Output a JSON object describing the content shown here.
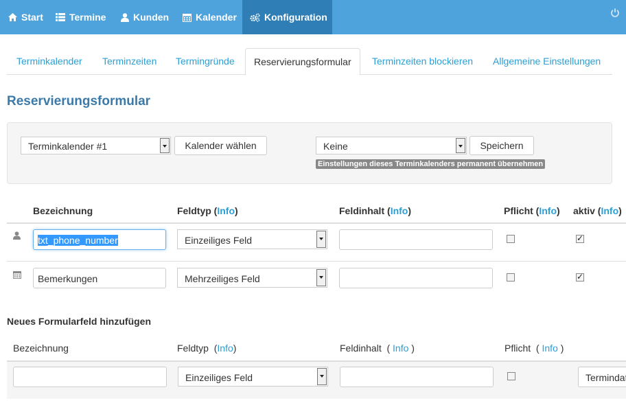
{
  "nav": {
    "items": [
      {
        "label": "Start",
        "icon": "home-icon"
      },
      {
        "label": "Termine",
        "icon": "list-icon"
      },
      {
        "label": "Kunden",
        "icon": "user-icon"
      },
      {
        "label": "Kalender",
        "icon": "calendar-icon"
      },
      {
        "label": "Konfiguration",
        "icon": "cogs-icon",
        "active": true
      }
    ],
    "power_icon": "power-icon"
  },
  "tabs": [
    {
      "label": "Terminkalender"
    },
    {
      "label": "Terminzeiten"
    },
    {
      "label": "Termingründe"
    },
    {
      "label": "Reservierungsformular",
      "active": true
    },
    {
      "label": "Terminzeiten blockieren"
    },
    {
      "label": "Allgemeine Einstellungen"
    }
  ],
  "page_title": "Reservierungsformular",
  "toolbar": {
    "calendar_select": "Terminkalender #1",
    "choose_button": "Kalender wählen",
    "preset_select": "Keine",
    "save_button": "Speichern",
    "hint": "Einstellungen dieses Terminkalenders permanent übernehmen"
  },
  "table": {
    "headers": {
      "bezeichnung": "Bezeichnung",
      "feldtyp": "Feldtyp",
      "feldinhalt": "Feldinhalt",
      "pflicht": "Pflicht",
      "aktiv": "aktiv",
      "info": "Info"
    },
    "rows": [
      {
        "icon": "user-icon",
        "name": "txt_phone_number",
        "type": "Einzeiliges Feld",
        "content": "",
        "required": false,
        "active": true
      },
      {
        "icon": "calendar-icon",
        "name": "Bemerkungen",
        "type": "Mehrzeiliges Feld",
        "content": "",
        "required": false,
        "active": true
      }
    ]
  },
  "new_field": {
    "title": "Neues Formularfeld hinzufügen",
    "headers": {
      "bezeichnung": "Bezeichnung",
      "feldtyp": "Feldtyp",
      "feldinhalt": "Feldinhalt",
      "pflicht": "Pflicht",
      "info": "Info"
    },
    "name": "",
    "type": "Einzeiliges Feld",
    "content": "",
    "required": false,
    "category_select": "Termindat"
  },
  "colors": {
    "nav": "#4ea3dd",
    "nav_active": "#2f7fb6",
    "link": "#2a9fd6",
    "title": "#3a79a8"
  }
}
